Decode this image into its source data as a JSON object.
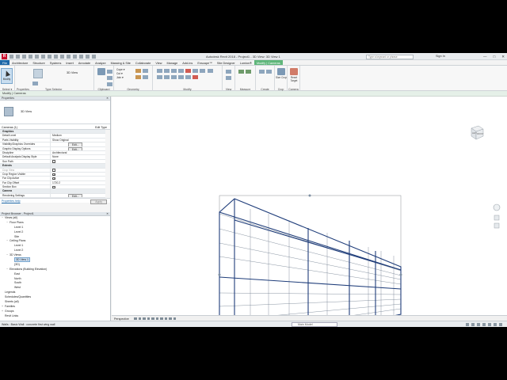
{
  "app": {
    "logo": "R",
    "window_title": "Autodesk Revit 2018 -  Project1 - 3D View: 3D View 1",
    "search_placeholder": "Type a keyword or phrase",
    "sign_in": "Sign In",
    "win_buttons": [
      "—",
      "□",
      "✕"
    ]
  },
  "tabs": [
    {
      "label": "File",
      "kind": "file"
    },
    {
      "label": "Architecture",
      "kind": "normal"
    },
    {
      "label": "Structure",
      "kind": "normal"
    },
    {
      "label": "Systems",
      "kind": "normal"
    },
    {
      "label": "Insert",
      "kind": "normal"
    },
    {
      "label": "Annotate",
      "kind": "normal"
    },
    {
      "label": "Analyze",
      "kind": "normal"
    },
    {
      "label": "Massing & Site",
      "kind": "normal"
    },
    {
      "label": "Collaborate",
      "kind": "normal"
    },
    {
      "label": "View",
      "kind": "normal"
    },
    {
      "label": "Manage",
      "kind": "normal"
    },
    {
      "label": "Add-Ins",
      "kind": "normal"
    },
    {
      "label": "Enscape™",
      "kind": "normal"
    },
    {
      "label": "Site Designer",
      "kind": "normal"
    },
    {
      "label": "Lumion®",
      "kind": "normal"
    },
    {
      "label": "Modify | Cameras",
      "kind": "active"
    }
  ],
  "ribbon": {
    "modify_label": "Modify",
    "select_label": "Select ▾",
    "properties_label": "Properties",
    "type_selector_value": "3D View",
    "type_selector_label": "Type Selector",
    "clipboard_label": "Clipboard",
    "geometry_label": "Geometry",
    "geometry_items": [
      "Cope ▾",
      "Cut ▾",
      "Join ▾"
    ],
    "modify_group_label": "Modify",
    "view_label": "View",
    "measure_label": "Measure",
    "create_label": "Create",
    "crop_btn": "Size Crop",
    "crop_label": "Crop",
    "reset_target": "Reset Target",
    "camera_label": "Camera"
  },
  "options_bar": "Modify | Cameras",
  "properties": {
    "title": "Properties",
    "close": "✕",
    "type_name": "3D View",
    "selector": "Cameras (1)",
    "edit_type": "Edit Type",
    "rows": [
      {
        "k": "Graphics",
        "v": "",
        "kind": "grp"
      },
      {
        "k": "Detail Level",
        "v": "Medium",
        "kind": "row"
      },
      {
        "k": "Parts Visibility",
        "v": "Show Original",
        "kind": "row"
      },
      {
        "k": "Visibility/Graphics Overrides",
        "v": "Edit...",
        "kind": "btn"
      },
      {
        "k": "Graphic Display Options",
        "v": "Edit...",
        "kind": "btn"
      },
      {
        "k": "Discipline",
        "v": "Architectural",
        "kind": "row"
      },
      {
        "k": "Default Analysis Display Style",
        "v": "None",
        "kind": "row"
      },
      {
        "k": "Sun Path",
        "v": "",
        "kind": "chk"
      },
      {
        "k": "Extents",
        "v": "",
        "kind": "grp"
      },
      {
        "k": "Crop View",
        "v": "",
        "kind": "gray"
      },
      {
        "k": "Crop Region Visible",
        "v": "✓",
        "kind": "chk"
      },
      {
        "k": "Far Clip Active",
        "v": "✓",
        "kind": "chk"
      },
      {
        "k": "Far Clip Offset",
        "v": "1720.2",
        "kind": "row"
      },
      {
        "k": "Section Box",
        "v": "",
        "kind": "chk"
      },
      {
        "k": "Camera",
        "v": "",
        "kind": "grp"
      },
      {
        "k": "Rendering Settings",
        "v": "Edit...",
        "kind": "btn"
      }
    ],
    "help_link": "Properties help",
    "apply": "Apply"
  },
  "browser": {
    "title": "Project Browser - Project1",
    "close": "✕",
    "nodes": [
      {
        "label": "Views (all)",
        "depth": 0,
        "toggle": "−"
      },
      {
        "label": "Floor Plans",
        "depth": 1,
        "toggle": "−"
      },
      {
        "label": "Level 1",
        "depth": 2,
        "toggle": ""
      },
      {
        "label": "Level 2",
        "depth": 2,
        "toggle": ""
      },
      {
        "label": "Site",
        "depth": 2,
        "toggle": ""
      },
      {
        "label": "Ceiling Plans",
        "depth": 1,
        "toggle": "−"
      },
      {
        "label": "Level 1",
        "depth": 2,
        "toggle": ""
      },
      {
        "label": "Level 2",
        "depth": 2,
        "toggle": ""
      },
      {
        "label": "3D Views",
        "depth": 1,
        "toggle": "−"
      },
      {
        "label": "3D View 1",
        "depth": 2,
        "toggle": "",
        "selected": true
      },
      {
        "label": "{3D}",
        "depth": 2,
        "toggle": ""
      },
      {
        "label": "Elevations (Building Elevation)",
        "depth": 1,
        "toggle": "−"
      },
      {
        "label": "East",
        "depth": 2,
        "toggle": ""
      },
      {
        "label": "North",
        "depth": 2,
        "toggle": ""
      },
      {
        "label": "South",
        "depth": 2,
        "toggle": ""
      },
      {
        "label": "West",
        "depth": 2,
        "toggle": ""
      },
      {
        "label": "Legends",
        "depth": 0,
        "toggle": ""
      },
      {
        "label": "Schedules/Quantities",
        "depth": 0,
        "toggle": ""
      },
      {
        "label": "Sheets (all)",
        "depth": 0,
        "toggle": ""
      },
      {
        "label": "Families",
        "depth": 0,
        "toggle": "+"
      },
      {
        "label": "Groups",
        "depth": 0,
        "toggle": "+"
      },
      {
        "label": "Revit Links",
        "depth": 0,
        "toggle": ""
      }
    ]
  },
  "viewcube": {
    "left": "LEFT",
    "front": "FRONT"
  },
  "viewbar": {
    "label": "Perspective"
  },
  "status": {
    "message": "Walls : Basic Wall : concrete first wing wall",
    "model": "Main Model"
  },
  "colors": {
    "file_tab": "#1d67a8",
    "context_tab": "#5fb67a",
    "wall_lines": "#1f3d7a"
  }
}
